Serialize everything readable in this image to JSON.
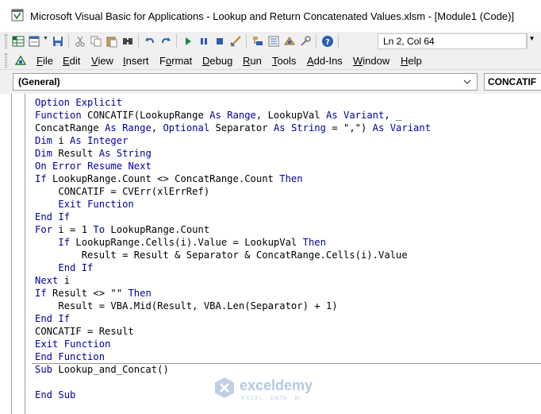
{
  "window": {
    "title": "Microsoft Visual Basic for Applications - Lookup and Return Concatenated Values.xlsm - [Module1 (Code)]"
  },
  "toolbar": {
    "status": "Ln 2, Col 64",
    "icons": [
      "view-excel-icon",
      "insert-userform-icon",
      "save-icon",
      "cut-icon",
      "copy-icon",
      "paste-icon",
      "find-icon",
      "undo-icon",
      "redo-icon",
      "run-icon",
      "break-icon",
      "reset-icon",
      "design-mode-icon",
      "project-explorer-icon",
      "properties-icon",
      "object-browser-icon",
      "toolbox-icon",
      "help-icon"
    ]
  },
  "menu": {
    "items": [
      {
        "label": "File",
        "u": "F",
        "rest": "ile"
      },
      {
        "label": "Edit",
        "u": "E",
        "rest": "dit"
      },
      {
        "label": "View",
        "u": "V",
        "rest": "iew"
      },
      {
        "label": "Insert",
        "u": "I",
        "rest": "nsert"
      },
      {
        "label": "Format",
        "pre": "F",
        "u": "o",
        "rest": "rmat"
      },
      {
        "label": "Debug",
        "u": "D",
        "rest": "ebug"
      },
      {
        "label": "Run",
        "u": "R",
        "rest": "un"
      },
      {
        "label": "Tools",
        "u": "T",
        "rest": "ools"
      },
      {
        "label": "Add-Ins",
        "u": "A",
        "rest": "dd-Ins"
      },
      {
        "label": "Window",
        "u": "W",
        "rest": "indow"
      },
      {
        "label": "Help",
        "u": "H",
        "rest": "elp"
      }
    ]
  },
  "combos": {
    "object": "(General)",
    "procedure": "CONCATIF"
  },
  "code": {
    "lines": [
      "Option Explicit",
      "Function CONCATIF(LookupRange As Range, LookupVal As Variant, _",
      "ConcatRange As Range, Optional Separator As String = \",\") As Variant",
      "Dim i As Integer",
      "Dim Result As String",
      "On Error Resume Next",
      "If LookupRange.Count <> ConcatRange.Count Then",
      "    CONCATIF = CVErr(xlErrRef)",
      "    Exit Function",
      "End If",
      "For i = 1 To LookupRange.Count",
      "    If LookupRange.Cells(i).Value = LookupVal Then",
      "        Result = Result & Separator & ConcatRange.Cells(i).Value",
      "    End If",
      "Next i",
      "If Result <> \"\" Then",
      "    Result = VBA.Mid(Result, VBA.Len(Separator) + 1)",
      "End If",
      "CONCATIF = Result",
      "Exit Function",
      "End Function",
      "Sub Lookup_and_Concat()",
      "",
      "End Sub"
    ]
  },
  "watermark": {
    "name": "exceldemy",
    "tagline": "EXCEL · DATA · BI"
  },
  "colors": {
    "keyword": "#0000a0",
    "code_text": "#000000",
    "toolbar_bg": "#f0f0f0"
  }
}
